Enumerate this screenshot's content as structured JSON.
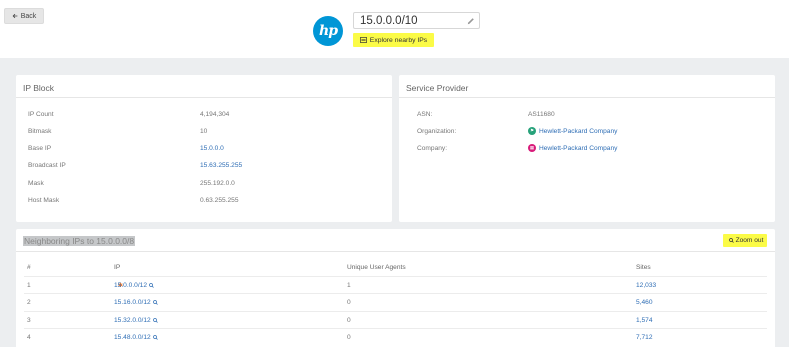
{
  "header": {
    "back_label": "Back",
    "logo_text": "hp",
    "search_value": "15.0.0.0/10",
    "explore_label": "Explore nearby IPs"
  },
  "ip_block": {
    "title": "IP Block",
    "rows": [
      {
        "label": "IP Count",
        "value": "4,194,304",
        "link": false
      },
      {
        "label": "Bitmask",
        "value": "10",
        "link": false
      },
      {
        "label": "Base IP",
        "value": "15.0.0.0",
        "link": true
      },
      {
        "label": "Broadcast IP",
        "value": "15.63.255.255",
        "link": true
      },
      {
        "label": "Mask",
        "value": "255.192.0.0",
        "link": false
      },
      {
        "label": "Host Mask",
        "value": "0.63.255.255",
        "link": false
      }
    ]
  },
  "service_provider": {
    "title": "Service Provider",
    "asn_label": "ASN:",
    "asn_value": "AS11680",
    "org_label": "Organization:",
    "org_value": "Hewlett-Packard Company",
    "org_icon_color": "#27a27a",
    "company_label": "Company:",
    "company_value": "Hewlett-Packard Company",
    "company_icon_color": "#d81b7a"
  },
  "neighbors": {
    "title": "Neighboring IPs to 15.0.0.0/8",
    "zoom_label": "Zoom out",
    "columns": [
      "#",
      "IP",
      "Unique User Agents",
      "Sites"
    ],
    "rows": [
      {
        "num": "1",
        "ip": "15.0.0.0/12",
        "agents": "1",
        "sites": "12,033",
        "current": true
      },
      {
        "num": "2",
        "ip": "15.16.0.0/12",
        "agents": "0",
        "sites": "5,460",
        "current": false
      },
      {
        "num": "3",
        "ip": "15.32.0.0/12",
        "agents": "0",
        "sites": "1,574",
        "current": false
      },
      {
        "num": "4",
        "ip": "15.48.0.0/12",
        "agents": "0",
        "sites": "7,712",
        "current": false
      }
    ]
  },
  "colors": {
    "accent_yellow": "#fbfb47",
    "link_blue": "#2f6eb5",
    "hp_blue": "#0096d6"
  }
}
